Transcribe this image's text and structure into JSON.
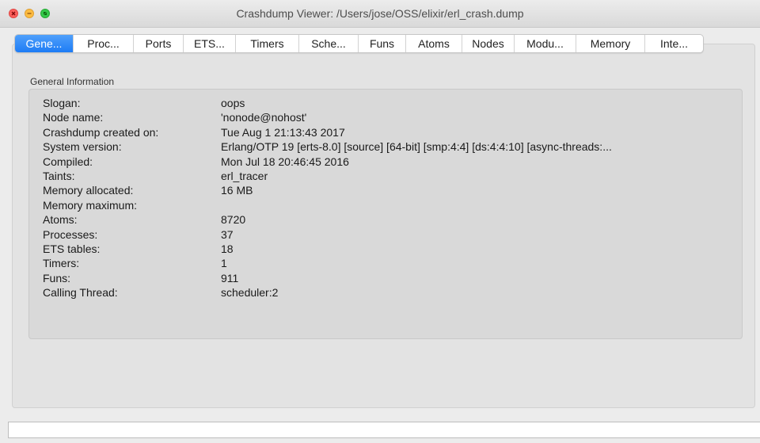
{
  "window": {
    "title": "Crashdump Viewer: /Users/jose/OSS/elixir/erl_crash.dump"
  },
  "tabs": [
    {
      "label": "Gene...",
      "active": true
    },
    {
      "label": "Proc..."
    },
    {
      "label": "Ports"
    },
    {
      "label": "ETS..."
    },
    {
      "label": "Timers"
    },
    {
      "label": "Sche..."
    },
    {
      "label": "Funs"
    },
    {
      "label": "Atoms"
    },
    {
      "label": "Nodes"
    },
    {
      "label": "Modu..."
    },
    {
      "label": "Memory"
    },
    {
      "label": "Inte..."
    }
  ],
  "general": {
    "heading": "General Information",
    "rows": [
      {
        "label": "Slogan:",
        "value": "oops"
      },
      {
        "label": "Node name:",
        "value": "'nonode@nohost'"
      },
      {
        "label": "Crashdump created on:",
        "value": "Tue Aug  1 21:13:43 2017"
      },
      {
        "label": "System version:",
        "value": "Erlang/OTP 19 [erts-8.0] [source] [64-bit] [smp:4:4] [ds:4:4:10] [async-threads:..."
      },
      {
        "label": "Compiled:",
        "value": "Mon Jul 18 20:46:45 2016"
      },
      {
        "label": "Taints:",
        "value": "erl_tracer"
      },
      {
        "label": "Memory allocated:",
        "value": "16 MB"
      },
      {
        "label": "Memory maximum:",
        "value": ""
      },
      {
        "label": "Atoms:",
        "value": "8720"
      },
      {
        "label": "Processes:",
        "value": "37"
      },
      {
        "label": "ETS tables:",
        "value": "18"
      },
      {
        "label": "Timers:",
        "value": "1"
      },
      {
        "label": "Funs:",
        "value": "911"
      },
      {
        "label": "Calling Thread:",
        "value": "scheduler:2"
      }
    ]
  },
  "status": {
    "text": ""
  },
  "colors": {
    "active_tab": "#1e7cf5",
    "close": "#fc605c",
    "minimize": "#fdbc40",
    "maximize": "#34c84a"
  }
}
